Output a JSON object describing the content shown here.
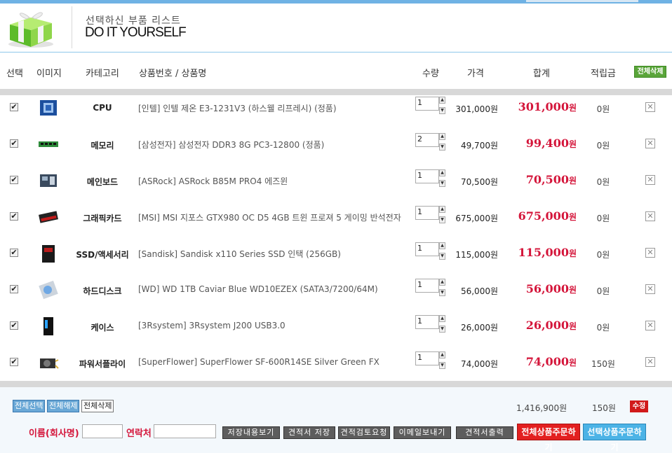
{
  "header": {
    "subtitle": "선택하신 부품 리스트",
    "title": "DO IT YOURSELF"
  },
  "columns": {
    "select": "선택",
    "image": "이미지",
    "category": "카테고리",
    "product": "상품번호 / 상품명",
    "qty": "수량",
    "price": "가격",
    "total": "합계",
    "points": "적립금",
    "delete_all": "전체삭제"
  },
  "rows": [
    {
      "category": "CPU",
      "name": "[인텔] 인텔 제온 E3-1231V3 (하스웰 리프레시) (정품)",
      "qty": "1",
      "price": "301,000원",
      "total": "301,000",
      "points": "0원",
      "checked": true,
      "icon": "cpu-image"
    },
    {
      "category": "메모리",
      "name": "[삼성전자] 삼성전자 DDR3 8G PC3-12800 (정품)",
      "qty": "2",
      "price": "49,700원",
      "total": "99,400",
      "points": "0원",
      "checked": true,
      "icon": "memory-image"
    },
    {
      "category": "메인보드",
      "name": "[ASRock] ASRock B85M PRO4 에즈윈",
      "qty": "1",
      "price": "70,500원",
      "total": "70,500",
      "points": "0원",
      "checked": true,
      "icon": "mainboard-image"
    },
    {
      "category": "그래픽카드",
      "name": "[MSI] MSI 지포스 GTX980 OC D5 4GB 트윈 프로져 5 게이밍 반석전자",
      "qty": "1",
      "price": "675,000원",
      "total": "675,000",
      "points": "0원",
      "checked": true,
      "icon": "graphics-card-image"
    },
    {
      "category": "SSD/액세서리",
      "name": "[Sandisk] Sandisk x110 Series SSD 인택 (256GB)",
      "qty": "1",
      "price": "115,000원",
      "total": "115,000",
      "points": "0원",
      "checked": true,
      "icon": "ssd-image"
    },
    {
      "category": "하드디스크",
      "name": "[WD] WD 1TB Caviar Blue WD10EZEX (SATA3/7200/64M)",
      "qty": "1",
      "price": "56,000원",
      "total": "56,000",
      "points": "0원",
      "checked": true,
      "icon": "hdd-image"
    },
    {
      "category": "케이스",
      "name": "[3Rsystem] 3Rsystem J200 USB3.0",
      "qty": "1",
      "price": "26,000원",
      "total": "26,000",
      "points": "0원",
      "checked": true,
      "icon": "case-image"
    },
    {
      "category": "파워서플라이",
      "name": "[SuperFlower] SuperFlower SF-600R14SE Silver Green FX",
      "qty": "1",
      "price": "74,000원",
      "total": "74,000",
      "points": "150원",
      "checked": true,
      "icon": "psu-image"
    }
  ],
  "won_suffix": "원",
  "footer": {
    "select_all": "전체선택",
    "deselect_all": "전체해제",
    "delete_all": "전체삭제",
    "sum_total": "1,416,900원",
    "sum_points": "150원",
    "edit": "수정",
    "name_label": "이름(회사명)",
    "contact_label": "연락처",
    "buttons": {
      "view_saved": "저장내용보기",
      "save_quote": "견적서 저장",
      "request_review": "견적검토요청",
      "send_email": "이메일보내기",
      "print_quote": "견적서출력",
      "order_all": "전체상품주문하기",
      "order_selected": "선택상품주문하기"
    }
  },
  "colors": {
    "accent_blue": "#6fb2e4",
    "price_red": "#d4153a",
    "green_button": "#5aa53a"
  }
}
